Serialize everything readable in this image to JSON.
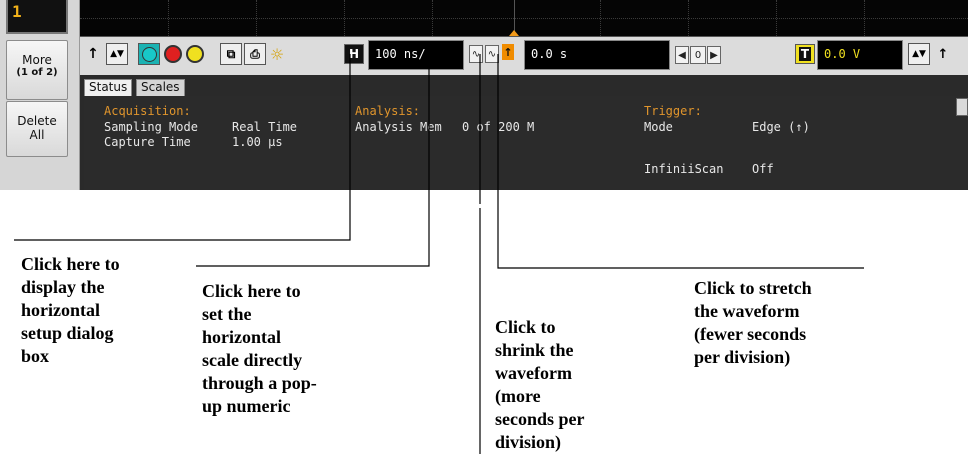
{
  "side_buttons": {
    "top_label": "1",
    "more": {
      "line1": "More",
      "line2": "(1 of 2)"
    },
    "delete": {
      "line1": "Delete",
      "line2": "All"
    }
  },
  "toolbar": {
    "horizontal_button": "H",
    "time_per_div": "100 ns/",
    "delay": "0.0 s",
    "delay_nav_value": "0",
    "trigger_button": "T",
    "trigger_level": "0.0 V",
    "colors": {
      "cyan": "#1bb3b3",
      "red": "#e02020",
      "yellow": "#f0e020",
      "orange": "#f08c00"
    }
  },
  "tabs": [
    {
      "label": "Status"
    },
    {
      "label": "Scales"
    }
  ],
  "status": {
    "acquisition": {
      "heading": "Acquisition:",
      "rows": [
        {
          "label": "Sampling Mode",
          "value": "Real Time"
        },
        {
          "label": "Capture Time",
          "value": "1.00 µs"
        }
      ]
    },
    "analysis": {
      "heading": "Analysis:",
      "rows": [
        {
          "label": "Analysis Mem",
          "value": "0 of 200 M"
        }
      ]
    },
    "trigger": {
      "heading": "Trigger:",
      "rows": [
        {
          "label": "Mode",
          "value": "Edge (↑)"
        },
        {
          "label": "InfiniiScan",
          "value": "Off"
        }
      ]
    }
  },
  "callouts": {
    "horizontal_setup": "Click here to\ndisplay the\nhorizontal\nsetup dialog\nbox",
    "scale_direct": "Click here to\nset the\nhorizontal\nscale directly\nthrough a pop-\nup numeric",
    "shrink": "Click to\nshrink the\nwaveform\n(more\nseconds per\ndivision)",
    "stretch": "Click to stretch\nthe waveform\n(fewer seconds\nper division)"
  }
}
